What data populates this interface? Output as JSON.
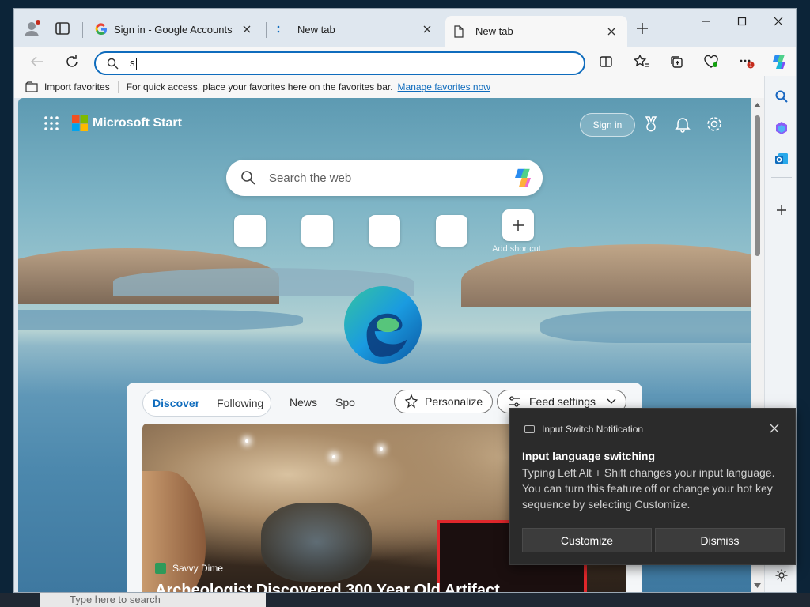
{
  "browser": {
    "tabs": [
      {
        "title": "Sign in - Google Accounts",
        "icon": "google-g-icon"
      },
      {
        "title": "New tab",
        "icon": "loading-icon"
      },
      {
        "title": "New tab",
        "icon": "page-icon",
        "active": true
      }
    ],
    "address_value": "s"
  },
  "favorites_bar": {
    "import_label": "Import favorites",
    "hint": "For quick access, place your favorites here on the favorites bar.",
    "manage_link": "Manage favorites now"
  },
  "start_page": {
    "brand": "Microsoft Start",
    "signin_label": "Sign in",
    "search_placeholder": "Search the web",
    "add_shortcut_label": "Add shortcut",
    "feed": {
      "tabs": [
        "Discover",
        "Following"
      ],
      "active_tab": "Discover",
      "nav": [
        "News",
        "Spo"
      ],
      "personalize_label": "Personalize",
      "feed_settings_label": "Feed settings",
      "article_source": "Savvy Dime",
      "article_headline": "Archeologist Discovered 300 Year Old Artifact"
    }
  },
  "notification": {
    "app_name": "Input Switch Notification",
    "title": "Input language switching",
    "body": "Typing Left Alt + Shift changes your input language. You can turn this feature off or change your hot key sequence by selecting Customize.",
    "customize_label": "Customize",
    "dismiss_label": "Dismiss"
  },
  "taskbar": {
    "search_placeholder": "Type here to search"
  },
  "colors": {
    "accent": "#0f6cbd",
    "toast_bg": "#2b2b2b"
  }
}
